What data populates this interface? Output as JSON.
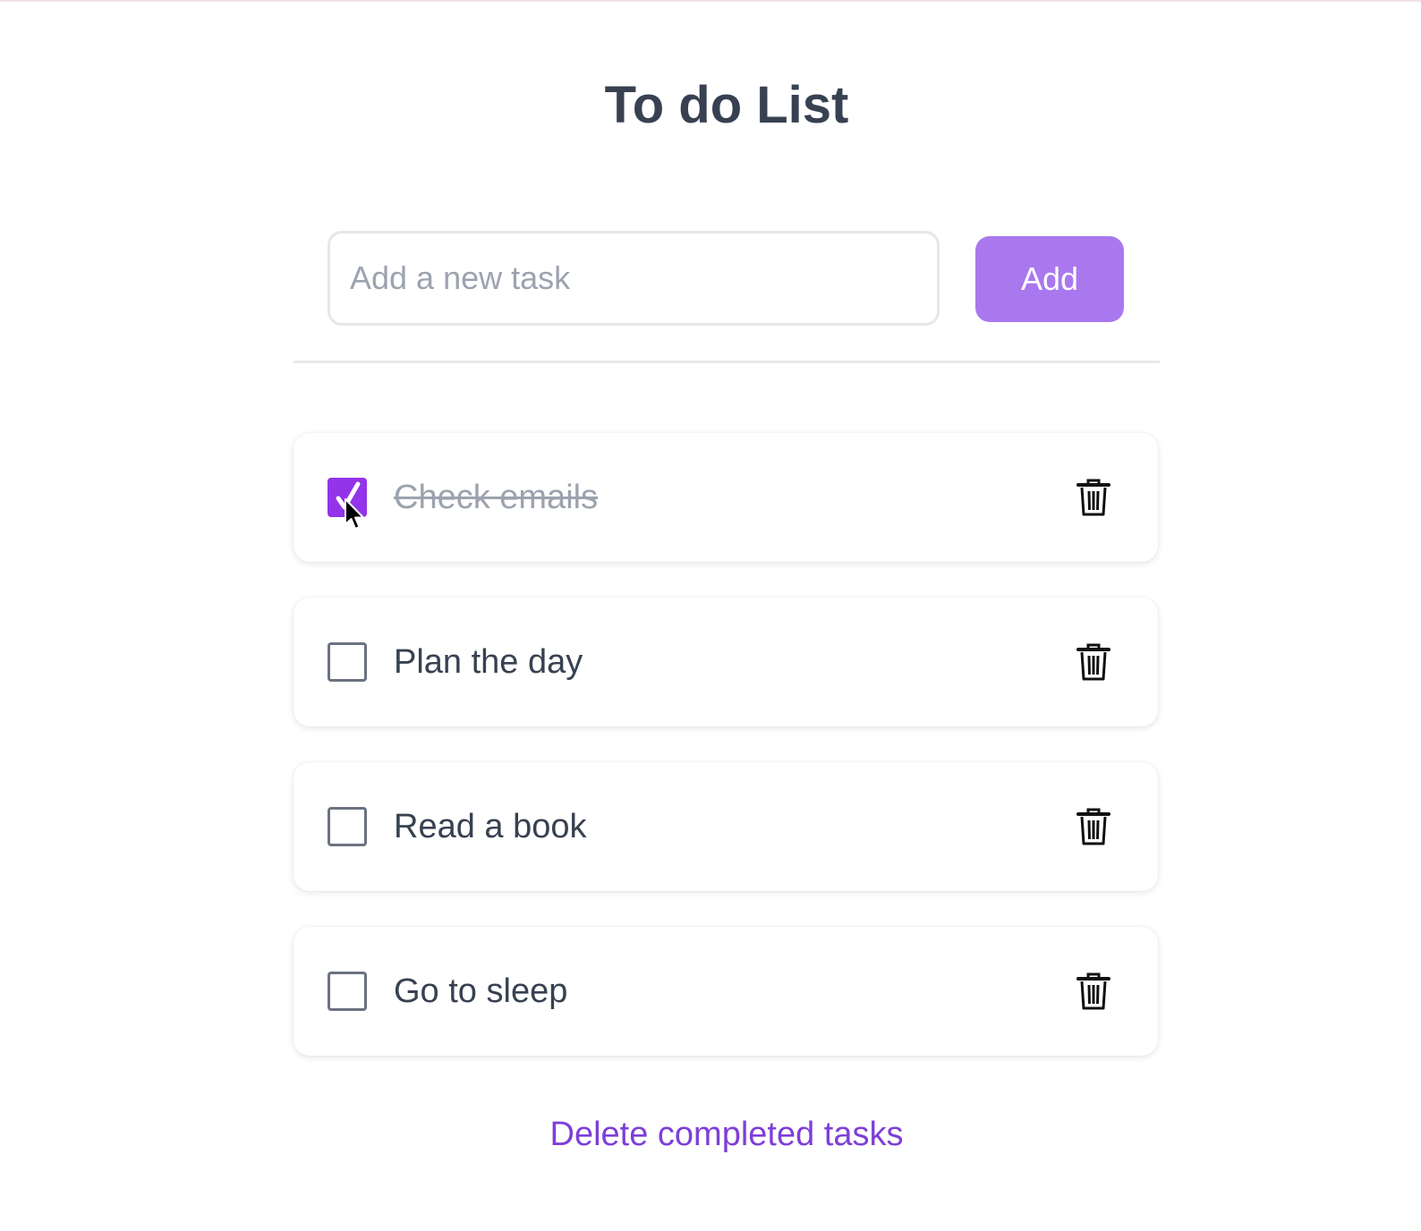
{
  "app": {
    "title": "To do List"
  },
  "new_task": {
    "placeholder": "Add a new task",
    "value": "",
    "add_label": "Add"
  },
  "tasks": [
    {
      "label": "Check emails",
      "completed": true
    },
    {
      "label": "Plan the day",
      "completed": false
    },
    {
      "label": "Read a book",
      "completed": false
    },
    {
      "label": "Go to sleep",
      "completed": false
    }
  ],
  "footer": {
    "delete_completed_label": "Delete completed tasks"
  },
  "colors": {
    "accent": "#9333ea",
    "add_button": "#a978ee",
    "link": "#7e3fd8",
    "text": "#374151"
  },
  "icons": {
    "delete": "trash-icon",
    "check": "checkmark-icon",
    "cursor": "mouse-pointer-icon"
  }
}
